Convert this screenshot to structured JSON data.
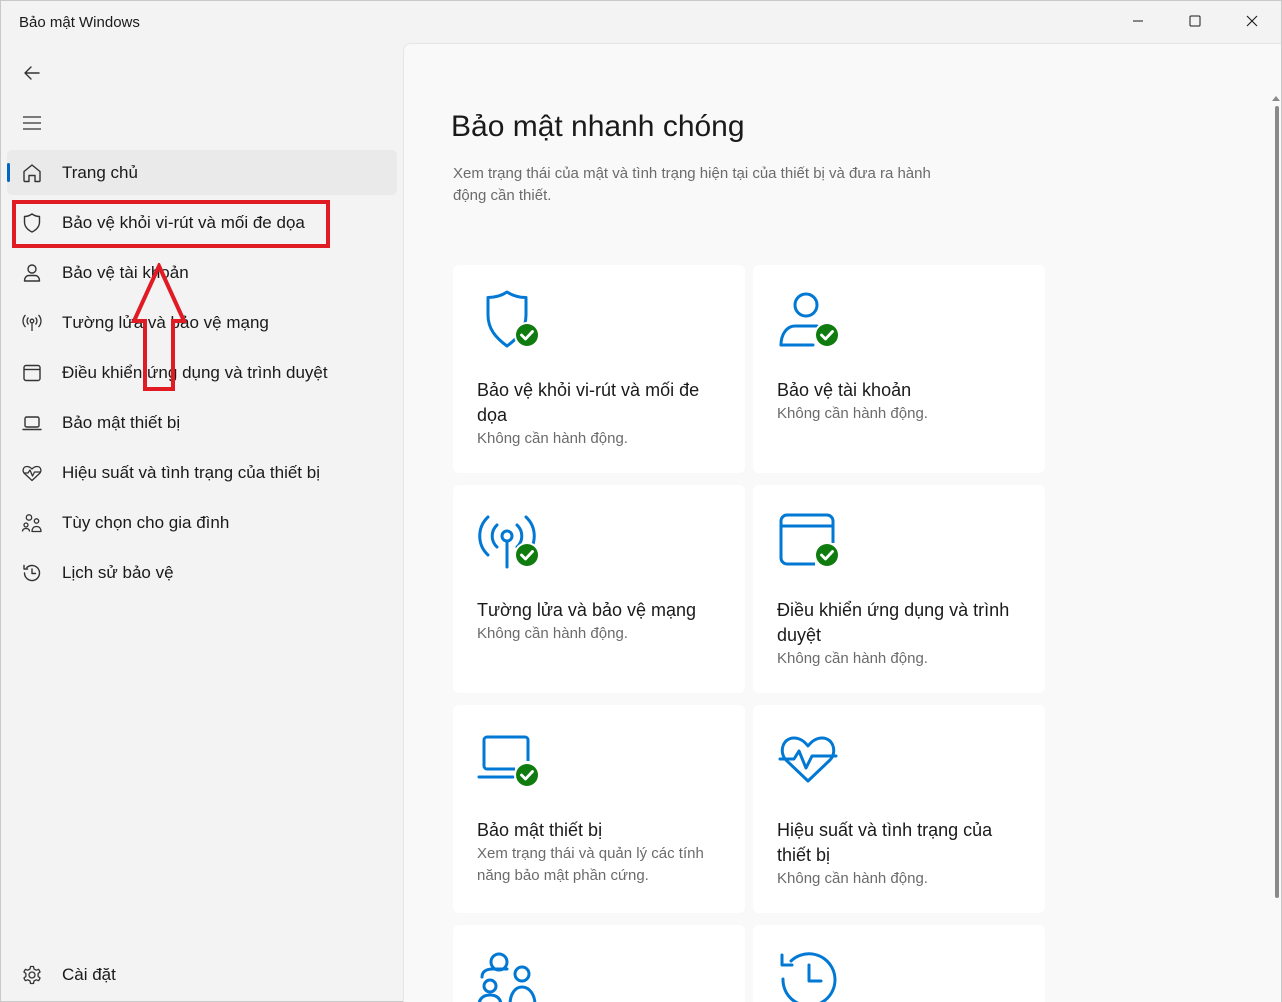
{
  "window": {
    "title": "Bảo mật Windows",
    "controls": {
      "minimize": "minimize-icon",
      "maximize": "maximize-icon",
      "close": "close-icon"
    }
  },
  "sidebar": {
    "items": [
      {
        "label": "Trang chủ",
        "icon": "home-icon"
      },
      {
        "label": "Bảo vệ khỏi vi-rút và mối đe dọa",
        "icon": "shield-icon"
      },
      {
        "label": "Bảo vệ tài khoản",
        "icon": "person-icon"
      },
      {
        "label": "Tường lửa và bảo vệ mạng",
        "icon": "antenna-icon"
      },
      {
        "label": "Điều khiển ứng dụng và trình duyệt",
        "icon": "browser-window-icon"
      },
      {
        "label": "Bảo mật thiết bị",
        "icon": "laptop-icon"
      },
      {
        "label": "Hiệu suất và tình trạng của thiết bị",
        "icon": "heart-pulse-icon"
      },
      {
        "label": "Tùy chọn cho gia đình",
        "icon": "family-icon"
      },
      {
        "label": "Lịch sử bảo vệ",
        "icon": "history-icon"
      }
    ],
    "settings_label": "Cài đặt",
    "active_index": 0
  },
  "main": {
    "title": "Bảo mật nhanh chóng",
    "description": "Xem trạng thái của mật và tình trạng hiện tại của thiết bị và đưa ra hành động cần thiết.",
    "cards": [
      {
        "title": "Bảo vệ khỏi vi-rút và mối đe dọa",
        "status": "Không cần hành động.",
        "icon": "shield-check-icon"
      },
      {
        "title": "Bảo vệ tài khoản",
        "status": "Không cần hành động.",
        "icon": "person-check-icon"
      },
      {
        "title": "Tường lửa và bảo vệ mạng",
        "status": "Không cần hành động.",
        "icon": "antenna-check-icon"
      },
      {
        "title": "Điều khiển ứng dụng và trình duyệt",
        "status": "Không cần hành động.",
        "icon": "browser-check-icon"
      },
      {
        "title": "Bảo mật thiết bị",
        "status": "Xem trạng thái và quản lý các tính năng bảo mật phần cứng.",
        "icon": "laptop-check-icon"
      },
      {
        "title": "Hiệu suất và tình trạng của thiết bị",
        "status": "Không cần hành động.",
        "icon": "heart-pulse-icon"
      },
      {
        "title": "",
        "status": "",
        "icon": "family-icon"
      },
      {
        "title": "",
        "status": "",
        "icon": "history-icon"
      }
    ]
  },
  "colors": {
    "accent": "#0067c0",
    "icon_blue": "#0078d4",
    "check_green": "#107c10",
    "annotation_red": "#e01b24"
  }
}
